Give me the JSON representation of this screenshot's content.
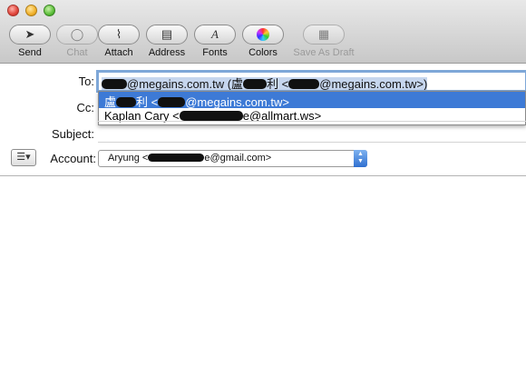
{
  "toolbar": {
    "items": [
      {
        "label": "Send",
        "icon": "paper-plane-icon",
        "glyph": "➤",
        "disabled": false
      },
      {
        "label": "Chat",
        "icon": "chat-bubble-icon",
        "glyph": "◯",
        "disabled": true
      },
      {
        "label": "Attach",
        "icon": "paperclip-icon",
        "glyph": "⌇",
        "disabled": false
      },
      {
        "label": "Address",
        "icon": "address-book-icon",
        "glyph": "▤",
        "disabled": false
      },
      {
        "label": "Fonts",
        "icon": "font-a-icon",
        "glyph": "A",
        "disabled": false
      },
      {
        "label": "Colors",
        "icon": "color-wheel-icon",
        "glyph": "●",
        "disabled": false
      },
      {
        "label": "Save As Draft",
        "icon": "draft-window-icon",
        "glyph": "▦",
        "disabled": true
      }
    ]
  },
  "headers": {
    "to_label": "To:",
    "cc_label": "Cc:",
    "subject_label": "Subject:",
    "account_label": "Account:"
  },
  "to_field": {
    "part1": "@megains.com.tw (盧",
    "part2": "利 <",
    "part3": "@megains.com.tw>)"
  },
  "autocomplete": {
    "row1_a": "盧",
    "row1_b": "利 <",
    "row1_c": "@megains.com.tw>",
    "row2_a": "Kaplan Cary <",
    "row2_b": "e@allmart.ws>"
  },
  "account": {
    "value_a": "Aryung <",
    "value_b": "e@gmail.com>"
  },
  "colors": {
    "selection_blue": "#3d7ad6",
    "focus_ring": "#7ea7d8"
  }
}
